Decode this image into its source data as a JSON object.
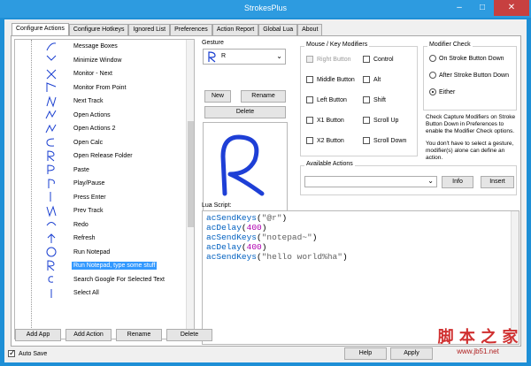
{
  "window": {
    "title": "StrokesPlus"
  },
  "tabs": [
    "Configure Actions",
    "Configure Hotkeys",
    "Ignored List",
    "Preferences",
    "Action Report",
    "Global Lua",
    "About"
  ],
  "actions": [
    {
      "label": "Message Boxes"
    },
    {
      "label": "Minimize Window"
    },
    {
      "label": "Monitor - Next"
    },
    {
      "label": "Monitor From Point"
    },
    {
      "label": "Next Track"
    },
    {
      "label": "Open Actions"
    },
    {
      "label": "Open Actions 2"
    },
    {
      "label": "Open Calc"
    },
    {
      "label": "Open Release Folder"
    },
    {
      "label": "Paste"
    },
    {
      "label": "Play/Pause"
    },
    {
      "label": "Press Enter"
    },
    {
      "label": "Prev Track"
    },
    {
      "label": "Redo"
    },
    {
      "label": "Refresh"
    },
    {
      "label": "Run Notepad"
    },
    {
      "label": "Run Notepad, type some stuff",
      "selected": true
    },
    {
      "label": "Search Google For Selected Text"
    },
    {
      "label": "Select All"
    }
  ],
  "list_buttons": {
    "add_app": "Add App",
    "add_action": "Add Action",
    "rename": "Rename",
    "delete": "Delete"
  },
  "gesture": {
    "label": "Gesture",
    "selected": "R",
    "new": "New",
    "rename": "Rename",
    "delete": "Delete"
  },
  "modifiers": {
    "label": "Mouse / Key Modifiers",
    "items": [
      "Right Button",
      "Control",
      "Middle Button",
      "Alt",
      "Left Button",
      "Shift",
      "X1 Button",
      "Scroll Up",
      "X2 Button",
      "Scroll Down"
    ]
  },
  "modifier_check": {
    "label": "Modifier Check",
    "options": [
      "On Stroke Button Down",
      "After Stroke Button Down",
      "Either"
    ],
    "selected": "Either",
    "note1": "Check Capture Modifiers on Stroke Button Down in Preferences to enable the Modifier Check options.",
    "note2": "You don't have to select a gesture, modifier(s) alone can define an action."
  },
  "available_actions": {
    "label": "Available Actions",
    "info": "Info",
    "insert": "Insert"
  },
  "lua": {
    "label": "Lua Script:",
    "lines": [
      {
        "fn": "acSendKeys",
        "arg": "\"@r\"",
        "argType": "st"
      },
      {
        "fn": "acDelay",
        "arg": "400",
        "argType": "nm"
      },
      {
        "fn": "acSendKeys",
        "arg": "\"notepad~\"",
        "argType": "st"
      },
      {
        "fn": "acDelay",
        "arg": "400",
        "argType": "nm"
      },
      {
        "fn": "acSendKeys",
        "arg": "\"hello world%ha\"",
        "argType": "st"
      }
    ]
  },
  "footer": {
    "auto_save": "Auto Save",
    "help": "Help",
    "apply": "Apply"
  },
  "watermark": {
    "text": "脚 本 之 家",
    "url": "www.jb51.net"
  }
}
